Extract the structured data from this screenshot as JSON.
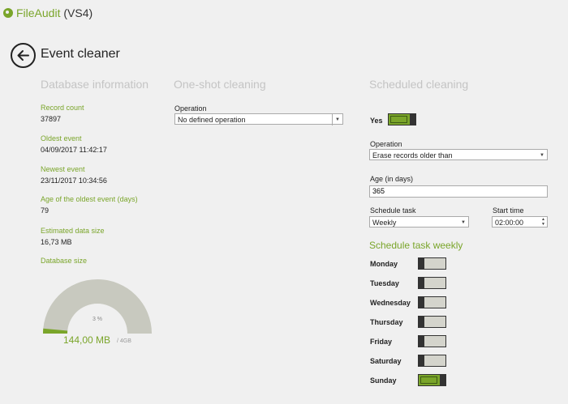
{
  "app": {
    "title_brand": "FileAudit",
    "title_suffix": " (VS4)"
  },
  "page": {
    "title": "Event cleaner"
  },
  "database_info": {
    "heading": "Database information",
    "fields": [
      {
        "label": "Record count",
        "value": "37897"
      },
      {
        "label": "Oldest event",
        "value": "04/09/2017 11:42:17"
      },
      {
        "label": "Newest event",
        "value": "23/11/2017 10:34:56"
      },
      {
        "label": "Age of the oldest event (days)",
        "value": "79"
      },
      {
        "label": "Estimated data size",
        "value": "16,73 MB"
      }
    ],
    "size_label": "Database size",
    "gauge": {
      "percent_text": "3 %",
      "used_fraction": 0.03,
      "used_text": "144,00 MB",
      "total_text": "/ 4GB"
    }
  },
  "one_shot": {
    "heading": "One-shot cleaning",
    "operation_label": "Operation",
    "operation_value": "No defined operation"
  },
  "scheduled": {
    "heading": "Scheduled cleaning",
    "enabled_label": "Yes",
    "enabled": true,
    "operation_label": "Operation",
    "operation_value": "Erase records older than",
    "age_label": "Age (in days)",
    "age_value": "365",
    "schedule_label": "Schedule task",
    "schedule_value": "Weekly",
    "start_label": "Start time",
    "start_value": "02:00:00",
    "weekly_heading": "Schedule task weekly",
    "days": [
      {
        "name": "Monday",
        "on": false
      },
      {
        "name": "Tuesday",
        "on": false
      },
      {
        "name": "Wednesday",
        "on": false
      },
      {
        "name": "Thursday",
        "on": false
      },
      {
        "name": "Friday",
        "on": false
      },
      {
        "name": "Saturday",
        "on": false
      },
      {
        "name": "Sunday",
        "on": true
      }
    ]
  },
  "colors": {
    "accent": "#7aa52a",
    "gauge_empty": "#c8c9bf",
    "muted": "#c4c4c4"
  }
}
